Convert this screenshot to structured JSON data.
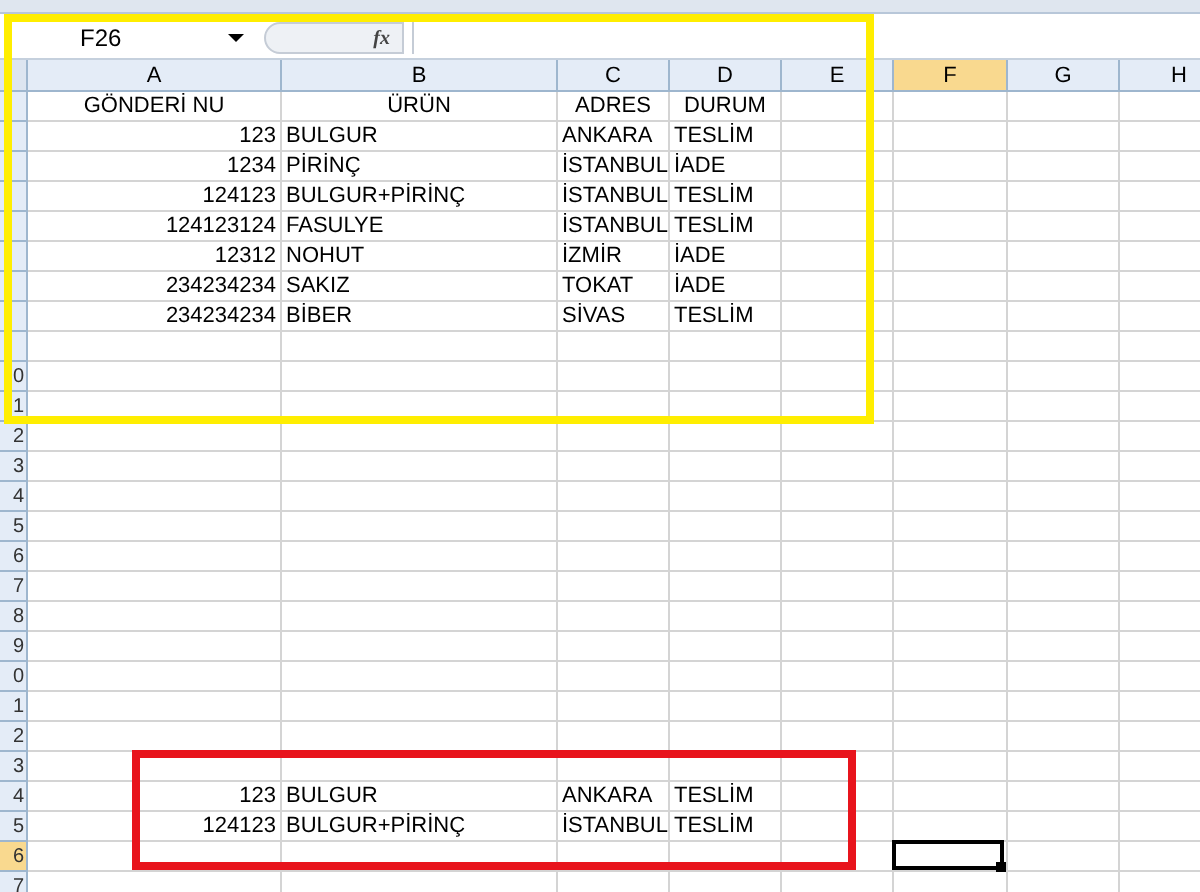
{
  "name_box": {
    "value": "F26"
  },
  "formula_bar": {
    "label": "fx"
  },
  "columns": [
    {
      "label": "A",
      "selected": false
    },
    {
      "label": "B",
      "selected": false
    },
    {
      "label": "C",
      "selected": false
    },
    {
      "label": "D",
      "selected": false
    },
    {
      "label": "E",
      "selected": false
    },
    {
      "label": "F",
      "selected": true
    },
    {
      "label": "G",
      "selected": false
    },
    {
      "label": "H",
      "selected": false
    }
  ],
  "rows": [
    {
      "kind": "header",
      "selected": false,
      "values": [
        "GÖNDERİ NU",
        "ÜRÜN",
        "ADRES",
        "DURUM"
      ]
    },
    {
      "kind": "data",
      "selected": false,
      "values": [
        "123",
        "BULGUR",
        "ANKARA",
        "TESLİM"
      ]
    },
    {
      "kind": "data",
      "selected": false,
      "values": [
        "1234",
        "PİRİNÇ",
        "İSTANBUL",
        "İADE"
      ]
    },
    {
      "kind": "data",
      "selected": false,
      "values": [
        "124123",
        "BULGUR+PİRİNÇ",
        "İSTANBUL",
        "TESLİM"
      ]
    },
    {
      "kind": "data",
      "selected": false,
      "values": [
        "124123124",
        "FASULYE",
        "İSTANBUL",
        "TESLİM"
      ]
    },
    {
      "kind": "data",
      "selected": false,
      "values": [
        "12312",
        "NOHUT",
        "İZMİR",
        "İADE"
      ]
    },
    {
      "kind": "data",
      "selected": false,
      "values": [
        "234234234",
        "SAKIZ",
        "TOKAT",
        "İADE"
      ]
    },
    {
      "kind": "data",
      "selected": false,
      "values": [
        "234234234",
        "BİBER",
        "SİVAS",
        "TESLİM"
      ]
    },
    {
      "kind": "data",
      "selected": false
    },
    {
      "kind": "data",
      "selected": false,
      "number": "0"
    },
    {
      "kind": "data",
      "selected": false,
      "number": "1"
    },
    {
      "kind": "data",
      "selected": false,
      "number": "2"
    },
    {
      "kind": "data",
      "selected": false,
      "number": "3"
    },
    {
      "kind": "data",
      "selected": false,
      "number": "4"
    },
    {
      "kind": "data",
      "selected": false,
      "number": "5"
    },
    {
      "kind": "data",
      "selected": false,
      "number": "6"
    },
    {
      "kind": "data",
      "selected": false,
      "number": "7"
    },
    {
      "kind": "data",
      "selected": false,
      "number": "8"
    },
    {
      "kind": "data",
      "selected": false,
      "number": "9"
    },
    {
      "kind": "data",
      "selected": false,
      "number": "0"
    },
    {
      "kind": "data",
      "selected": false,
      "number": "1"
    },
    {
      "kind": "data",
      "selected": false,
      "number": "2"
    },
    {
      "kind": "data",
      "selected": false,
      "number": "3"
    },
    {
      "kind": "data",
      "selected": false,
      "number": "4",
      "values": [
        "123",
        "BULGUR",
        "ANKARA",
        "TESLİM"
      ]
    },
    {
      "kind": "data",
      "selected": false,
      "number": "5",
      "values": [
        "124123",
        "BULGUR+PİRİNÇ",
        "İSTANBUL",
        "TESLİM"
      ]
    },
    {
      "kind": "data",
      "selected": true,
      "number": "6"
    },
    {
      "kind": "data",
      "selected": false,
      "number": "7"
    }
  ],
  "highlight_boxes": [
    {
      "color": "#ffee00"
    },
    {
      "color": "#e8141c"
    }
  ]
}
